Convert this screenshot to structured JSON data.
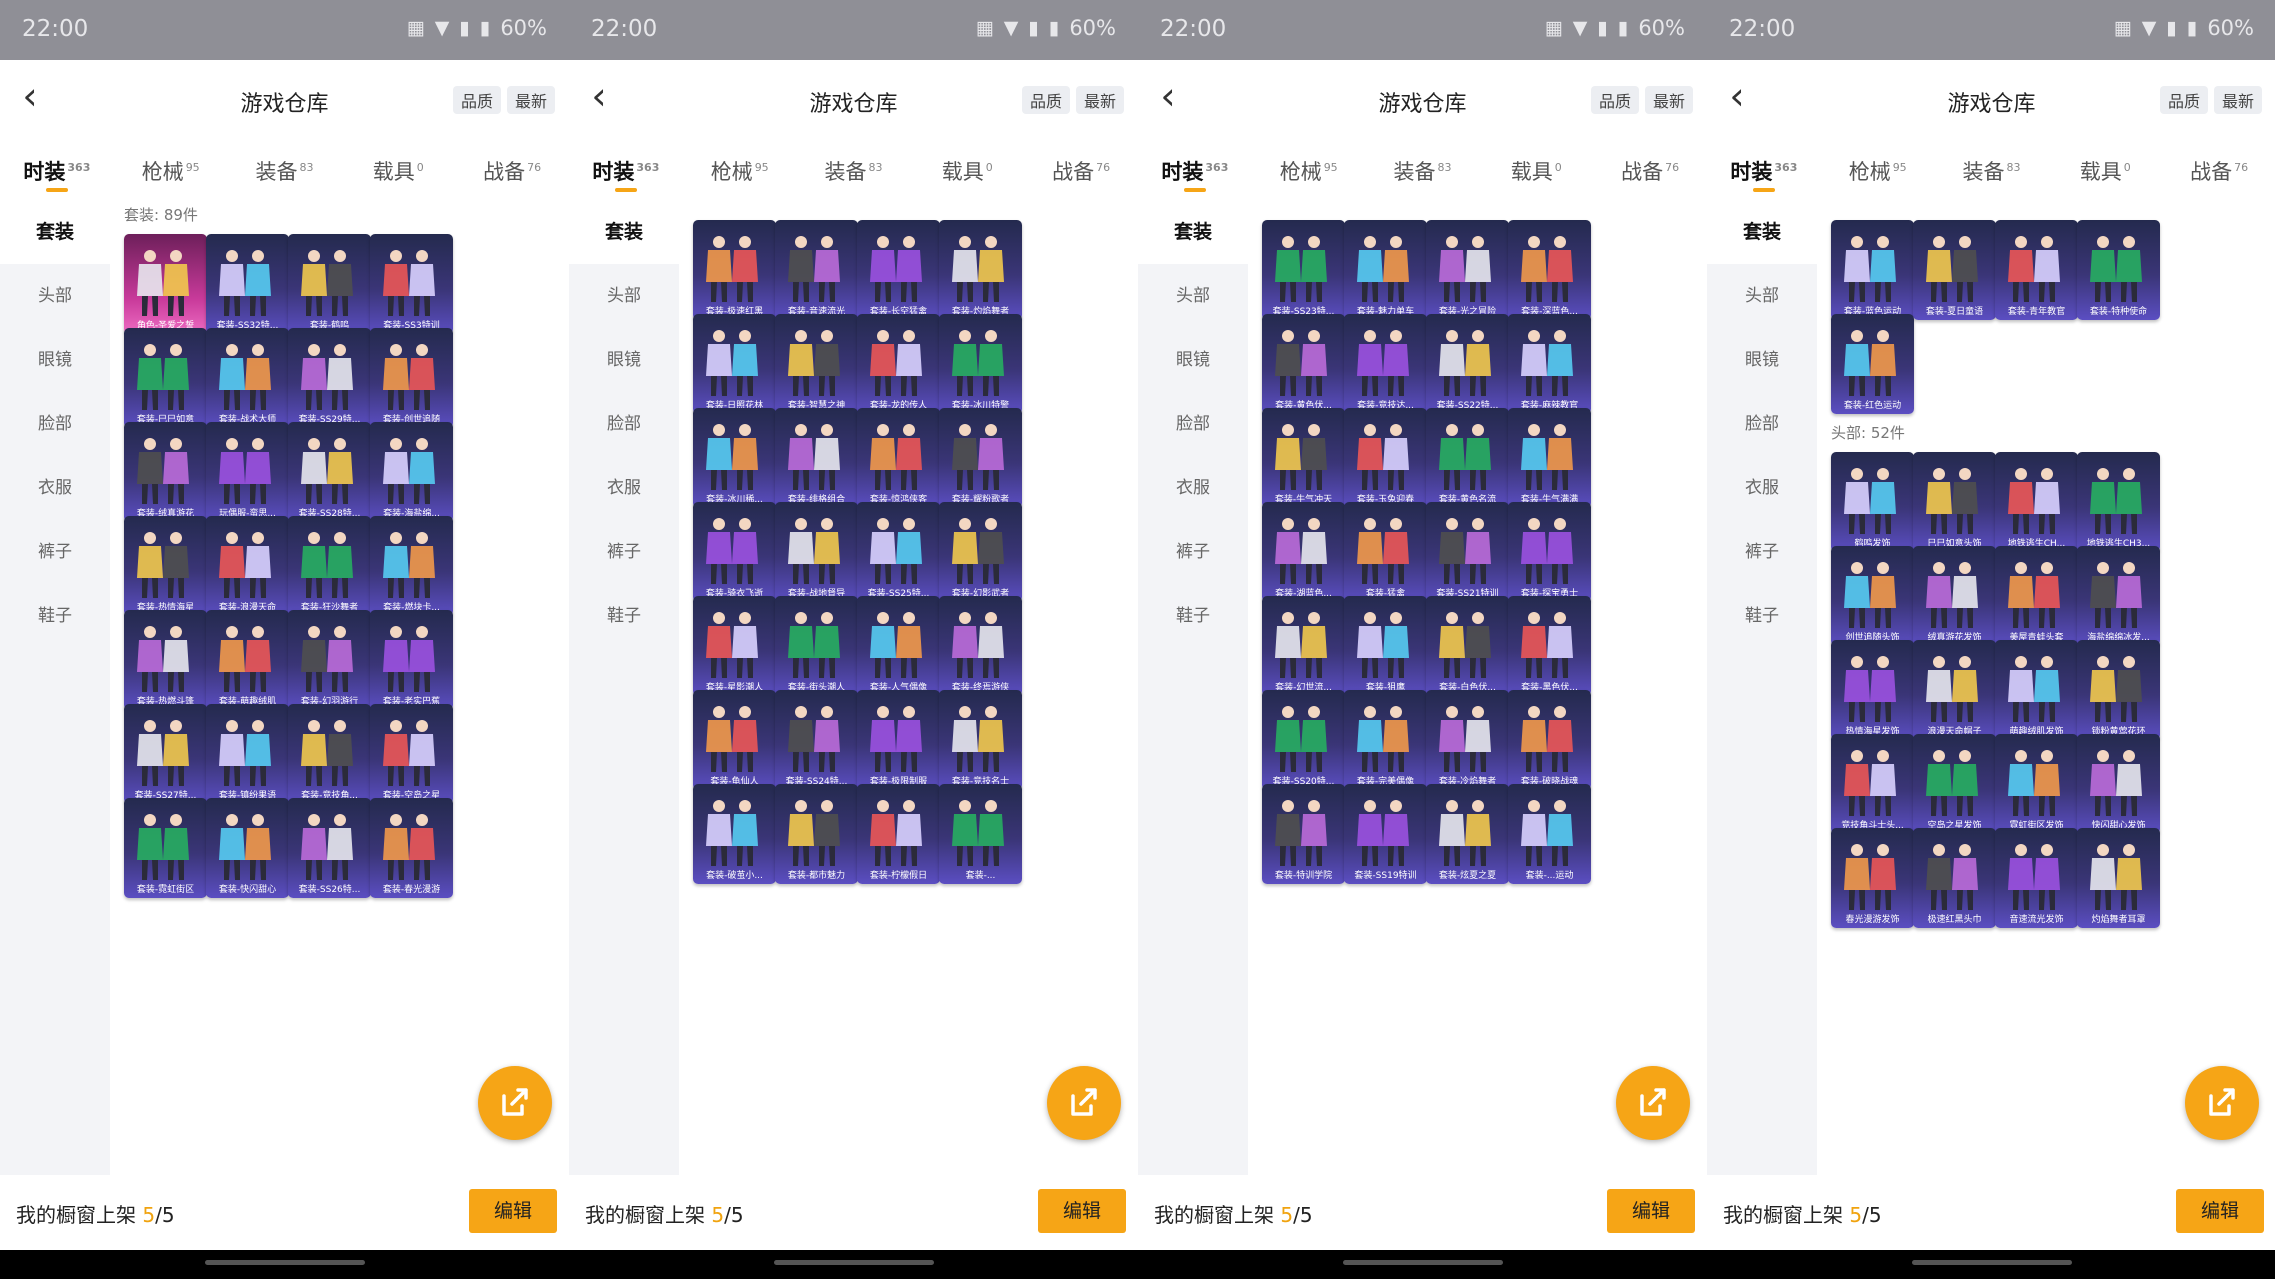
{
  "status": {
    "time": "22:00",
    "battery": "60%"
  },
  "header": {
    "title": "游戏仓库",
    "sort_quality": "品质",
    "sort_newest": "最新"
  },
  "tabs": [
    {
      "label": "时装",
      "count": "363"
    },
    {
      "label": "枪械",
      "count": "95"
    },
    {
      "label": "装备",
      "count": "83"
    },
    {
      "label": "载具",
      "count": "0"
    },
    {
      "label": "战备",
      "count": "76"
    }
  ],
  "sidebar": [
    "套装",
    "头部",
    "眼镜",
    "脸部",
    "衣服",
    "裤子",
    "鞋子"
  ],
  "bottom": {
    "label": "我的橱窗上架 ",
    "count": "5",
    "total": "/5",
    "edit": "编辑"
  },
  "colors": {
    "accent": "#f6a516",
    "tile_bg": "#3a3577",
    "tile_pink": "#c83a9a"
  },
  "screens": [
    {
      "sections": [
        {
          "label": "套装: 89件",
          "items": [
            "角色-圣爱之誓",
            "套装-SS32特...",
            "套装-鹤鸣",
            "套装-SS3特训",
            "套装-巳巳如意",
            "套装-战术大师",
            "套装-SS29特...",
            "套装-创世追随",
            "套装-绒真游花",
            "玩偶服-蛮思...",
            "套装-SS28特...",
            "套装-海盐绵...",
            "套装-热情海星",
            "套装-浪漫天命",
            "套装-狂沙舞者",
            "套装-燃块卡...",
            "套装-热燃斗篷",
            "套装-萌趣绒肌",
            "套装-幻羽游行",
            "套装-老实巴蕉",
            "套装-SS27特...",
            "套装-镇纷果语",
            "套装-竞技角...",
            "套装-空岛之星",
            "套装-霓虹街区",
            "套装-快闪甜心",
            "套装-SS26特...",
            "套装-春光漫游"
          ]
        }
      ]
    },
    {
      "sections": [
        {
          "label": "",
          "items": [
            "套装-极速红黑",
            "套装-音速流光",
            "套装-长空猛禽",
            "套装-灼焰舞者",
            "套装-日照花林",
            "套装-智慧之神",
            "套装-龙的传人",
            "套装-冰川特警",
            "套装-冰川稀...",
            "套装-绯格组合",
            "套装-惊鸿侠客",
            "套装-耀粉歌者",
            "套装-骑衣飞逝",
            "套装-战地督导",
            "套装-SS25特...",
            "套装-幻影武者",
            "套装-星影潮人",
            "套装-街头潮人",
            "套装-人气偶像",
            "套装-终焉游侠",
            "套装-龟仙人",
            "套装-SS24特...",
            "套装-极限制服",
            "套装-竞技名士",
            "套装-破茧小...",
            "套装-都市魅力",
            "套装-柠檬假日",
            "套装-..."
          ]
        }
      ]
    },
    {
      "sections": [
        {
          "label": "",
          "items": [
            "套装-SS23特...",
            "套装-魅力单车",
            "套装-光之冒险",
            "套装-深蓝色...",
            "套装-黄色伏...",
            "套装-竞技达...",
            "套装-SS22特...",
            "套装-麻辣教官",
            "套装-牛气冲天",
            "套装-玉兔迎春",
            "套装-黄色名流",
            "套装-牛气满满",
            "套装-湖蓝色...",
            "套装-猛禽",
            "套装-SS21特训",
            "套装-探宝勇士",
            "套装-幻世流...",
            "套装-狙鹰",
            "套装-白色伏...",
            "套装-黑色伏...",
            "套装-SS20特...",
            "套装-完美偶像",
            "套装-冷焰舞者",
            "套装-破晓战魂",
            "套装-特训学院",
            "套装-SS19特训",
            "套装-炫夏之夏",
            "套装-...运动"
          ]
        }
      ]
    },
    {
      "sections": [
        {
          "label": "",
          "items": [
            "套装-蓝色运动",
            "套装-夏日童语",
            "套装-青年教官",
            "套装-特种使命",
            "套装-红色运动"
          ]
        },
        {
          "label": "头部: 52件",
          "items": [
            "鹤鸣发饰",
            "巳巳如意头饰",
            "地铁逃生CH...",
            "地铁逃生CH3...",
            "创世追随头饰",
            "绒真游花发饰",
            "美屋青蛙头套",
            "海盐绵绵冰发...",
            "热情海星发饰",
            "浪漫天命帽子",
            "萌趣绒肌发饰",
            "锁粉黄莺花环",
            "竞技角斗士头...",
            "空岛之星发饰",
            "霓虹街区发饰",
            "快闪甜心发饰",
            "春光漫游发饰",
            "极速红黑头巾",
            "音速流光发饰",
            "灼焰舞者耳罩"
          ]
        }
      ]
    }
  ]
}
